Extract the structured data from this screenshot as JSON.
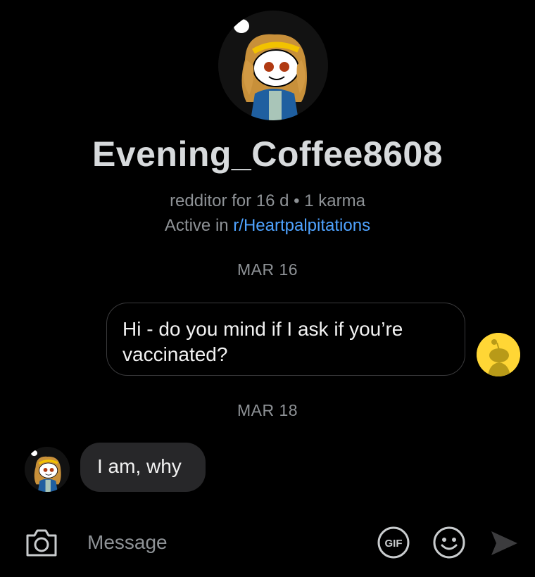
{
  "profile": {
    "username": "Evening_Coffee8608",
    "meta": "redditor for 16 d • 1 karma",
    "active_prefix": "Active in ",
    "community": "r/Heartpalpitations",
    "avatar_icon": "snoo-avatar-icon"
  },
  "messages": [
    {
      "date": "MAR 16",
      "text": "Hi - do you mind if I ask if you’re vaccinated?",
      "sender": "me"
    },
    {
      "date": "MAR 18",
      "text": "I am, why",
      "sender": "them"
    }
  ],
  "composer": {
    "placeholder": "Message",
    "camera_icon": "camera-icon",
    "gif_icon": "gif-icon",
    "emoji_icon": "emoji-icon",
    "send_icon": "send-icon"
  },
  "colors": {
    "background": "#000000",
    "link": "#4fa3ff",
    "muted": "#8e9296",
    "incoming_bubble": "#272729",
    "my_avatar": "#ffd635"
  }
}
